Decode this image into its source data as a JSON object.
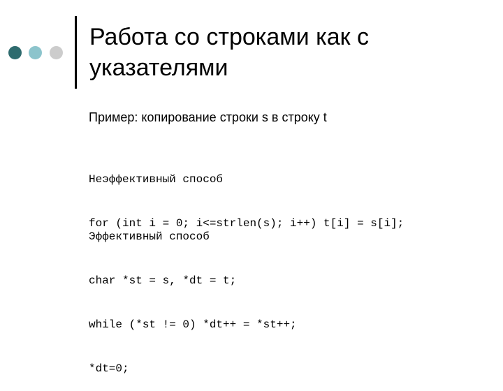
{
  "decoration": {
    "dots": [
      {
        "name": "dark-teal",
        "color": "#2e6b6e"
      },
      {
        "name": "light-teal",
        "color": "#8cc4cc"
      },
      {
        "name": "light-gray",
        "color": "#cccccc"
      }
    ]
  },
  "slide": {
    "title_line1": "Работа со строками как с",
    "title_line2": "указателями",
    "subtitle": "Пример: копирование строки s в строку t",
    "inefficient": {
      "heading": "Неэффективный способ",
      "lines": [
        "for (int i = 0; i<=strlen(s); i++) t[i] = s[i];"
      ]
    },
    "efficient": {
      "heading": "Эффективный способ",
      "lines": [
        "char *st = s, *dt = t;",
        "while (*st != 0) *dt++ = *st++;",
        "*dt=0;"
      ]
    }
  }
}
